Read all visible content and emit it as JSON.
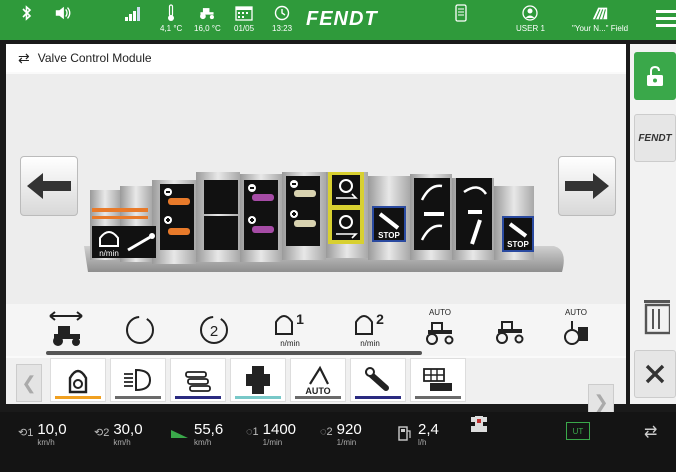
{
  "topbar": {
    "temperature": "4,1 °C",
    "tractor_temp": "16,0 °C",
    "date": "01/05",
    "time": "13:23",
    "brand": "FENDT",
    "user": "USER 1",
    "field": "\"Your N...\" Field",
    "icons": [
      "bluetooth-icon",
      "volume-icon",
      "signal-icon",
      "thermometer-icon",
      "tractor-icon",
      "calendar-icon",
      "clock-icon",
      "phone-icon",
      "user-icon",
      "field-icon",
      "menu-icon"
    ]
  },
  "module": {
    "title": "Valve Control Module"
  },
  "valve_labels": {
    "rpm": "n/min",
    "stop1": "STOP",
    "stop2": "STOP"
  },
  "functions": {
    "items": [
      {
        "name": "float-position",
        "label": ""
      },
      {
        "name": "timer-1",
        "label": ""
      },
      {
        "name": "timer-2",
        "label": ""
      },
      {
        "name": "flow-1",
        "label": "n/min",
        "num": "1"
      },
      {
        "name": "flow-2",
        "label": "n/min",
        "num": "2"
      },
      {
        "name": "auto-tractor",
        "label": "",
        "top": "AUTO"
      },
      {
        "name": "tractor",
        "label": ""
      },
      {
        "name": "auto-valve",
        "label": "",
        "top": "AUTO"
      }
    ]
  },
  "tabs": {
    "items": [
      {
        "name": "engine",
        "color": "#f0a020"
      },
      {
        "name": "lights",
        "color": "#6a6a6a"
      },
      {
        "name": "hoses",
        "color": "#2a2a80"
      },
      {
        "name": "valve",
        "color": "#78c8c8"
      },
      {
        "name": "auto",
        "label": "AUTO",
        "color": "#6a6a6a"
      },
      {
        "name": "coupling",
        "color": "#2a2a80"
      },
      {
        "name": "display",
        "color": "#6a6a6a"
      }
    ]
  },
  "status": {
    "timer1": {
      "value": "10,0",
      "unit": "km/h"
    },
    "timer2": {
      "value": "30,0",
      "unit": "km/h"
    },
    "speed": {
      "value": "55,6",
      "unit": "km/h"
    },
    "rpm1": {
      "value": "1400",
      "unit": "1/min"
    },
    "rpm2": {
      "value": "920",
      "unit": "1/min"
    },
    "fuel": {
      "value": "2,4",
      "unit": "l/h"
    },
    "ut_label": "UT"
  },
  "colors": {
    "brand_green": "#2f9a3b",
    "highlight_yellow": "#d8d030",
    "stop_blue": "#2a4aa0"
  }
}
